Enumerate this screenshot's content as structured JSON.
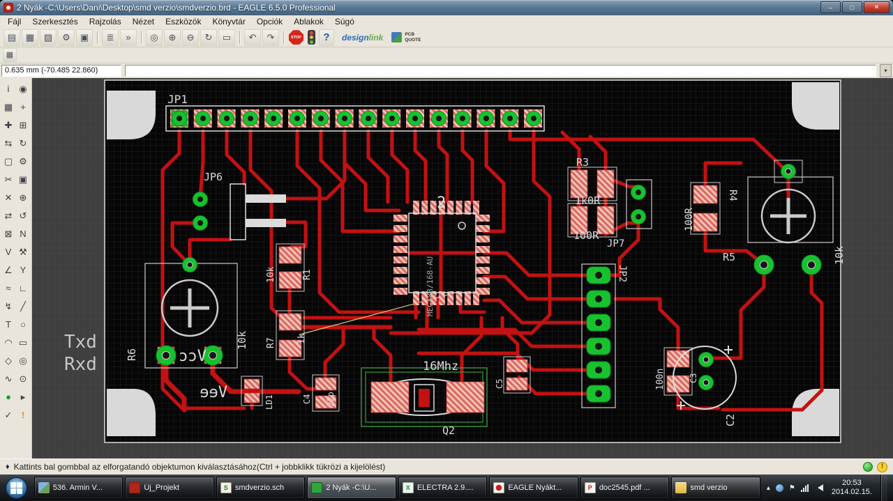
{
  "window": {
    "title": "2 Nyák -C:\\Users\\Dani\\Desktop\\smd verzio\\smdverzio.brd - EAGLE 6.5.0 Professional"
  },
  "titlebar_icons": {
    "minimize": "–",
    "maximize": "□",
    "close": "✕"
  },
  "menu": {
    "items": [
      "Fájl",
      "Szerkesztés",
      "Rajzolás",
      "Nézet",
      "Eszközök",
      "Könyvtár",
      "Opciók",
      "Ablakok",
      "Súgó"
    ]
  },
  "toolbar": {
    "buttons": [
      {
        "name": "open-board",
        "glyph": "▤"
      },
      {
        "name": "save",
        "glyph": "▦"
      },
      {
        "name": "print",
        "glyph": "▨"
      },
      {
        "name": "cam-processor",
        "glyph": "⚙"
      },
      {
        "name": "switch-editor",
        "glyph": "▣"
      },
      {
        "name": "script",
        "glyph": "≣"
      },
      {
        "name": "run",
        "glyph": "»"
      },
      {
        "name": "zoom-fit",
        "glyph": "◎"
      },
      {
        "name": "zoom-in",
        "glyph": "⊕"
      },
      {
        "name": "zoom-out",
        "glyph": "⊖"
      },
      {
        "name": "zoom-redraw",
        "glyph": "↻"
      },
      {
        "name": "zoom-select",
        "glyph": "▭"
      },
      {
        "name": "undo",
        "glyph": "↶"
      },
      {
        "name": "redo",
        "glyph": "↷"
      }
    ],
    "stop_label": "STOP",
    "help_glyph": "?",
    "designlink": {
      "part1": "design",
      "part2": "link"
    },
    "pcbquote": {
      "line1": "PCB",
      "line2": "QUOTE"
    }
  },
  "toolbar2": {
    "grid_glyph": "▦"
  },
  "coordbar": {
    "coordinates": "0.635 mm (-70.485 22.860)",
    "command_value": "",
    "dropdown_glyph": "▾"
  },
  "palette": {
    "tools": [
      {
        "name": "info",
        "glyph": "i"
      },
      {
        "name": "show",
        "glyph": "◉"
      },
      {
        "name": "display",
        "glyph": "▦"
      },
      {
        "name": "mark",
        "glyph": "+"
      },
      {
        "name": "move",
        "glyph": "✚"
      },
      {
        "name": "copy",
        "glyph": "⊞"
      },
      {
        "name": "mirror",
        "glyph": "⇆"
      },
      {
        "name": "rotate",
        "glyph": "↻"
      },
      {
        "name": "group",
        "glyph": "▢"
      },
      {
        "name": "change",
        "glyph": "⚙"
      },
      {
        "name": "cut",
        "glyph": "✂"
      },
      {
        "name": "paste",
        "glyph": "▣"
      },
      {
        "name": "delete",
        "glyph": "✕"
      },
      {
        "name": "add",
        "glyph": "⊕"
      },
      {
        "name": "pinswap",
        "glyph": "⇄"
      },
      {
        "name": "replace",
        "glyph": "↺"
      },
      {
        "name": "lock",
        "glyph": "⊠"
      },
      {
        "name": "name",
        "glyph": "N"
      },
      {
        "name": "value",
        "glyph": "V"
      },
      {
        "name": "smash",
        "glyph": "⚒"
      },
      {
        "name": "miter",
        "glyph": "∠"
      },
      {
        "name": "split",
        "glyph": "Y"
      },
      {
        "name": "optimize",
        "glyph": "≈"
      },
      {
        "name": "route",
        "glyph": "∟"
      },
      {
        "name": "ripup",
        "glyph": "↯"
      },
      {
        "name": "wire",
        "glyph": "╱"
      },
      {
        "name": "text",
        "glyph": "T"
      },
      {
        "name": "circle",
        "glyph": "○"
      },
      {
        "name": "arc",
        "glyph": "◠"
      },
      {
        "name": "rect",
        "glyph": "▭"
      },
      {
        "name": "polygon",
        "glyph": "◇"
      },
      {
        "name": "via",
        "glyph": "◎"
      },
      {
        "name": "signal",
        "glyph": "∿"
      },
      {
        "name": "hole",
        "glyph": "⊙"
      },
      {
        "name": "ratsnest",
        "glyph": "●"
      },
      {
        "name": "auto",
        "glyph": "▸"
      },
      {
        "name": "drc",
        "glyph": "✓"
      },
      {
        "name": "errors",
        "glyph": "!"
      }
    ]
  },
  "board": {
    "labels": [
      {
        "id": "jp1",
        "text": "JP1"
      },
      {
        "id": "jp6",
        "text": "JP6"
      },
      {
        "id": "r3",
        "text": "R3"
      },
      {
        "id": "r3-value",
        "text": "1k0R"
      },
      {
        "id": "r3b-value",
        "text": "100R"
      },
      {
        "id": "jp7",
        "text": "JP7"
      },
      {
        "id": "r4",
        "text": "R4"
      },
      {
        "id": "r4-value",
        "text": "100R"
      },
      {
        "id": "r5",
        "text": "R5"
      },
      {
        "id": "r5-value",
        "text": "10k"
      },
      {
        "id": "jp2",
        "text": "JP2"
      },
      {
        "id": "r1-value",
        "text": "10k"
      },
      {
        "id": "r1",
        "text": "R1"
      },
      {
        "id": "r7",
        "text": "R7"
      },
      {
        "id": "r7-value",
        "text": "1k"
      },
      {
        "id": "r6-value",
        "text": "10k"
      },
      {
        "id": "r6",
        "text": "R6"
      },
      {
        "id": "txd",
        "text": "Txd"
      },
      {
        "id": "rxd",
        "text": "Rxd"
      },
      {
        "id": "vcc-mirrored",
        "text": "Vcc"
      },
      {
        "id": "vee-mirrored",
        "text": "Vee"
      },
      {
        "id": "ld1",
        "text": "LD1"
      },
      {
        "id": "c4",
        "text": "C4"
      },
      {
        "id": "c4-value",
        "text": "22p"
      },
      {
        "id": "q2-value",
        "text": "16Mhz"
      },
      {
        "id": "q2",
        "text": "Q2"
      },
      {
        "id": "c5",
        "text": "C5"
      },
      {
        "id": "c3-value",
        "text": "100n"
      },
      {
        "id": "c3",
        "text": "C3"
      },
      {
        "id": "c2",
        "text": "C2"
      },
      {
        "id": "ic2-value",
        "text": "MEGA88/168-AU"
      },
      {
        "id": "ic2",
        "text": "2"
      }
    ]
  },
  "status": {
    "bullet": "♦",
    "text": "Kattints bal gombbal az elforgatandó objektumon kiválasztásához(Ctrl + jobbklikk tükrözi a kijelölést)",
    "warn_glyph": "!"
  },
  "taskbar": {
    "items": [
      {
        "label": "536. Armin V...",
        "icon": "photo",
        "glyph": ""
      },
      {
        "label": "Új_Projekt",
        "icon": "eagle",
        "glyph": ""
      },
      {
        "label": "smdverzio.sch",
        "icon": "schematic",
        "glyph": "S"
      },
      {
        "label": "2 Nyák -C:\\U...",
        "icon": "board",
        "glyph": ""
      },
      {
        "label": "ELECTRA 2.9....",
        "icon": "electra",
        "glyph": "X"
      },
      {
        "label": "EAGLE Nyákt...",
        "icon": "eagle-doc",
        "glyph": ""
      },
      {
        "label": "doc2545.pdf ...",
        "icon": "pdf",
        "glyph": "P"
      },
      {
        "label": "smd verzio",
        "icon": "folder",
        "glyph": ""
      }
    ],
    "tray": {
      "expand": "▴",
      "flag": "⚑"
    },
    "clock": {
      "time": "20:53",
      "date": "2014.02.15."
    }
  }
}
